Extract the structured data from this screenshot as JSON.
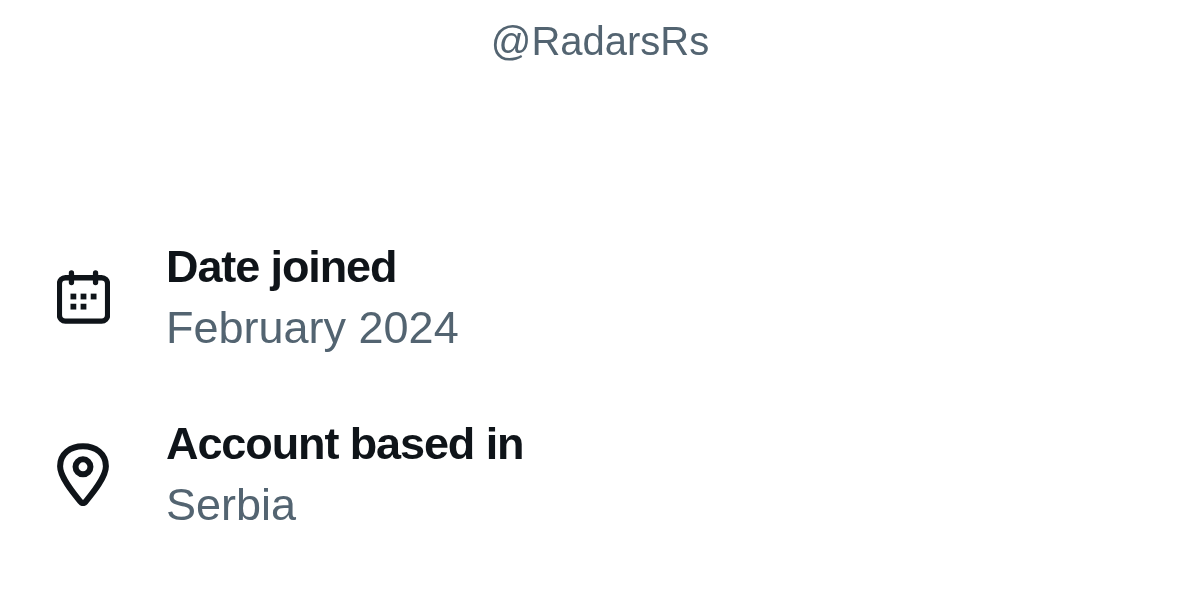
{
  "profile": {
    "handle": "@RadarsRs"
  },
  "details": [
    {
      "kind": "calendar",
      "label": "Date joined",
      "value": "February 2024"
    },
    {
      "kind": "location",
      "label": "Account based in",
      "value": "Serbia"
    }
  ]
}
